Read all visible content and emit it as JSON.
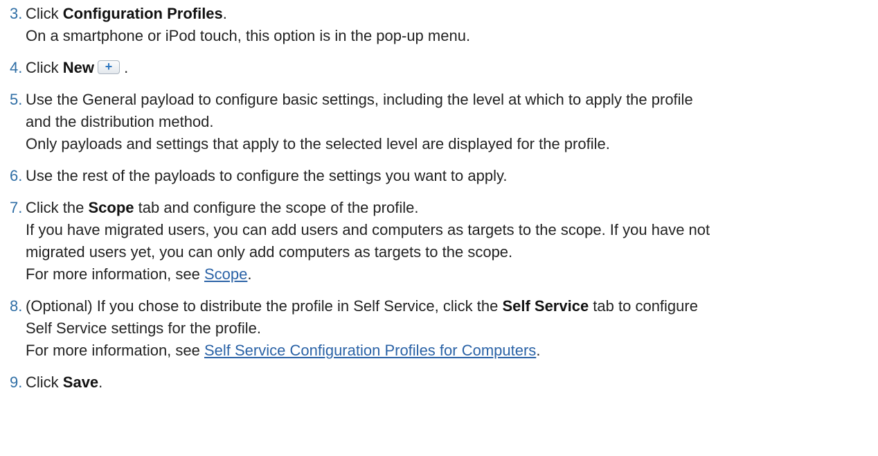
{
  "steps": [
    {
      "num": "3.",
      "lines": [
        {
          "pre": "Click ",
          "bold": "Configuration Profiles",
          "post": "."
        },
        {
          "text": "On a smartphone or iPod touch, this option is in the pop-up menu."
        }
      ]
    },
    {
      "num": "4.",
      "pre": "Click ",
      "bold": "New",
      "post": " .",
      "button_icon": "+"
    },
    {
      "num": "5.",
      "lines": [
        {
          "text": "Use the General payload to configure basic settings, including the level at which to apply the profile"
        },
        {
          "text": "and the distribution method."
        },
        {
          "text": "Only payloads and settings that apply to the selected level are displayed for the profile."
        }
      ]
    },
    {
      "num": "6.",
      "lines": [
        {
          "text": "Use the rest of the payloads to configure the settings you want to apply."
        }
      ]
    },
    {
      "num": "7.",
      "line1": {
        "pre": "Click the ",
        "bold": "Scope",
        "post": " tab and configure the scope of the profile."
      },
      "line2": "If you have migrated users, you can add users and computers as targets to the scope. If you have not",
      "line3": "migrated users yet, you can only add computers as targets to the scope.",
      "line4": {
        "pre": "For more information, see ",
        "link": "Scope",
        "post": "."
      }
    },
    {
      "num": "8.",
      "line1": {
        "pre": "(Optional) If you chose to distribute the profile in Self Service, click the ",
        "bold": "Self Service",
        "post": " tab to configure"
      },
      "line2": "Self Service settings for the profile.",
      "line3": {
        "pre": "For more information, see ",
        "link": "Self Service Configuration Profiles for Computers",
        "post": "."
      }
    },
    {
      "num": "9.",
      "pre": "Click ",
      "bold": "Save",
      "post": "."
    }
  ]
}
